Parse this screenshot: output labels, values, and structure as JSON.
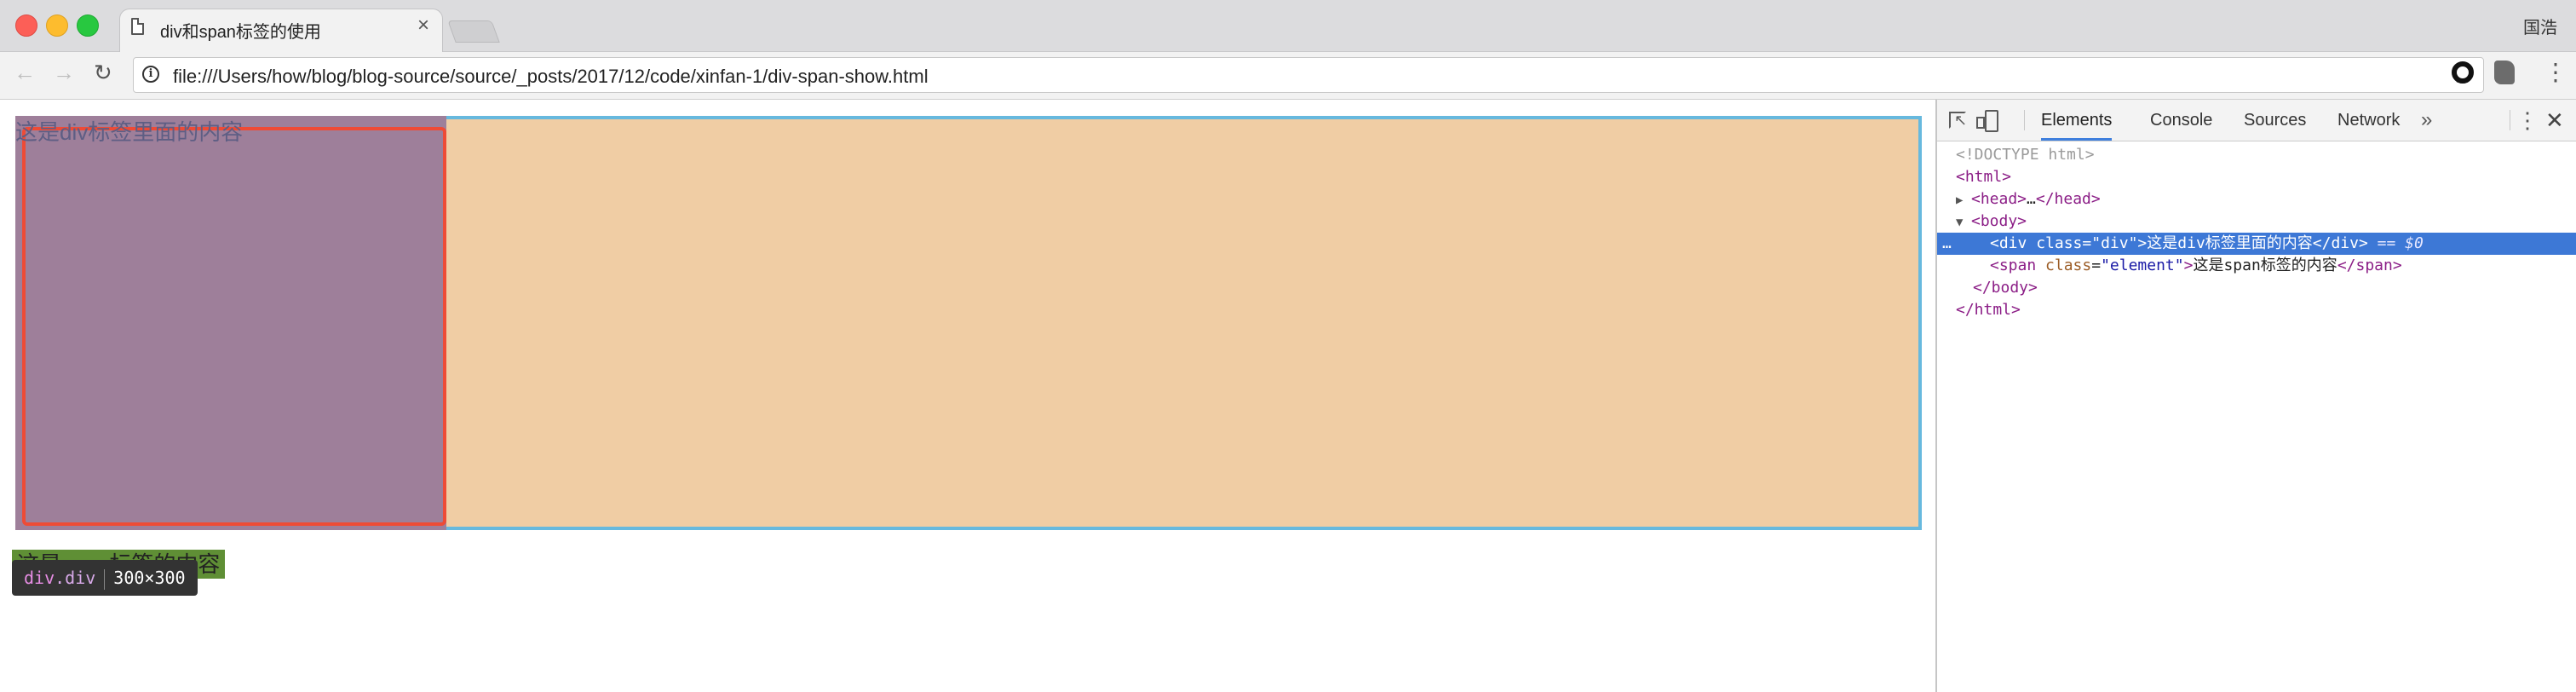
{
  "window": {
    "tab_title": "div和span标签的使用",
    "tab_close": "×",
    "profile_name": "国浩"
  },
  "toolbar": {
    "back": "←",
    "forward": "→",
    "reload": "↻",
    "info": "i",
    "url": "file:///Users/how/blog/blog-source/source/_posts/2017/12/code/xinfan-1/div-span-show.html",
    "star": "☆",
    "menu": "⋮"
  },
  "page": {
    "div_text": "这是div标签里面的内容",
    "span_text": "这是span标签的内容",
    "tooltip": {
      "tag": "div",
      "class": ".div",
      "size": "300×300"
    }
  },
  "devtools": {
    "tabs": [
      "Elements",
      "Console",
      "Sources",
      "Network"
    ],
    "active_tab": "Elements",
    "more": "»",
    "menu": "⋮",
    "close": "✕",
    "dom": {
      "doctype": "<!DOCTYPE html>",
      "html_open": "<html>",
      "head_open": "<head>",
      "head_ellipsis": "…",
      "head_close": "</head>",
      "body_open": "<body>",
      "div_open": "<div",
      "div_attr": "class",
      "div_val": "\"div\"",
      "div_gt": ">",
      "div_text": "这是div标签里面的内容",
      "div_close": "</div>",
      "div_marker": "== $0",
      "span_open": "<span",
      "span_attr": "class",
      "span_val": "\"element\"",
      "span_gt": ">",
      "span_text": "这是span标签的内容",
      "span_close": "</span>",
      "body_close": "</body>",
      "html_close": "</html>",
      "selected_dots": "…",
      "eq": "="
    }
  }
}
